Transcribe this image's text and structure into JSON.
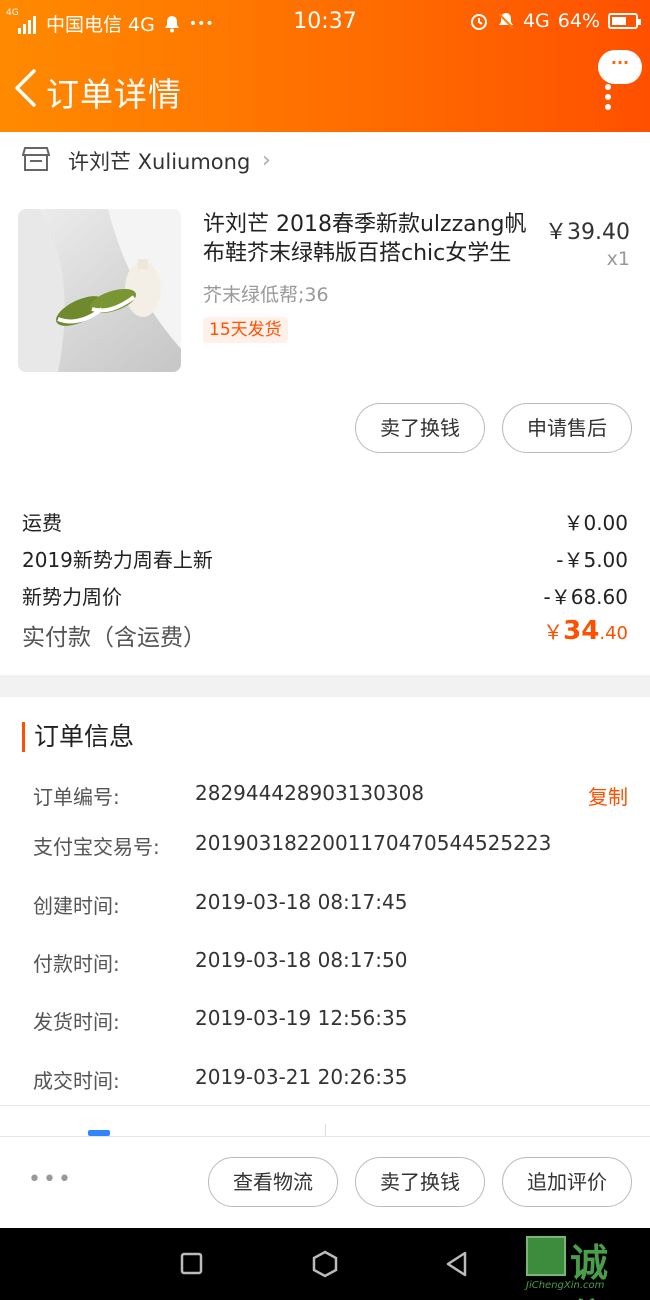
{
  "status_bar": {
    "network_small": "4G",
    "carrier": "中国电信 4G",
    "overflow": "•••",
    "time": "10:37",
    "network": "4G",
    "battery": "64%",
    "battery_level": 0.64
  },
  "header": {
    "title": "订单详情",
    "bubble": "···"
  },
  "store": {
    "name": "许刘芒 Xuliumong"
  },
  "product": {
    "title": "许刘芒 2018春季新款ulzzang帆布鞋芥末绿韩版百搭chic女学生",
    "price": "￥39.40",
    "quantity": "x1",
    "sku": "芥末绿低帮;36",
    "tag": "15天发货"
  },
  "product_actions": {
    "sell": "卖了换钱",
    "after_sale": "申请售后"
  },
  "fees": [
    {
      "label": "运费",
      "value": "￥0.00"
    },
    {
      "label": "2019新势力周春上新",
      "value": "-￥5.00"
    },
    {
      "label": "新势力周价",
      "value": "-￥68.60"
    }
  ],
  "total": {
    "label": "实付款（含运费）",
    "currency": "￥",
    "integer": "34",
    "decimal": ".40"
  },
  "order_info": {
    "title": "订单信息",
    "copy_label": "复制",
    "rows": [
      {
        "label": "订单编号:",
        "value": "282944428903130308"
      },
      {
        "label": "支付宝交易号:",
        "value": "2019031822001170470544525223"
      },
      {
        "label": "创建时间:",
        "value": "2019-03-18 08:17:45"
      },
      {
        "label": "付款时间:",
        "value": "2019-03-18 08:17:50"
      },
      {
        "label": "发货时间:",
        "value": "2019-03-19 12:56:35"
      },
      {
        "label": "成交时间:",
        "value": "2019-03-21 20:26:35"
      }
    ]
  },
  "bottom_actions": {
    "more": "•••",
    "logistics": "查看物流",
    "sell": "卖了换钱",
    "review": "追加评价"
  },
  "watermark": {
    "text": "诚信",
    "sub": "JiChengXin.com"
  },
  "colors": {
    "accent": "#ff5000",
    "header_start": "#ff8a00",
    "header_end": "#ff5000"
  }
}
